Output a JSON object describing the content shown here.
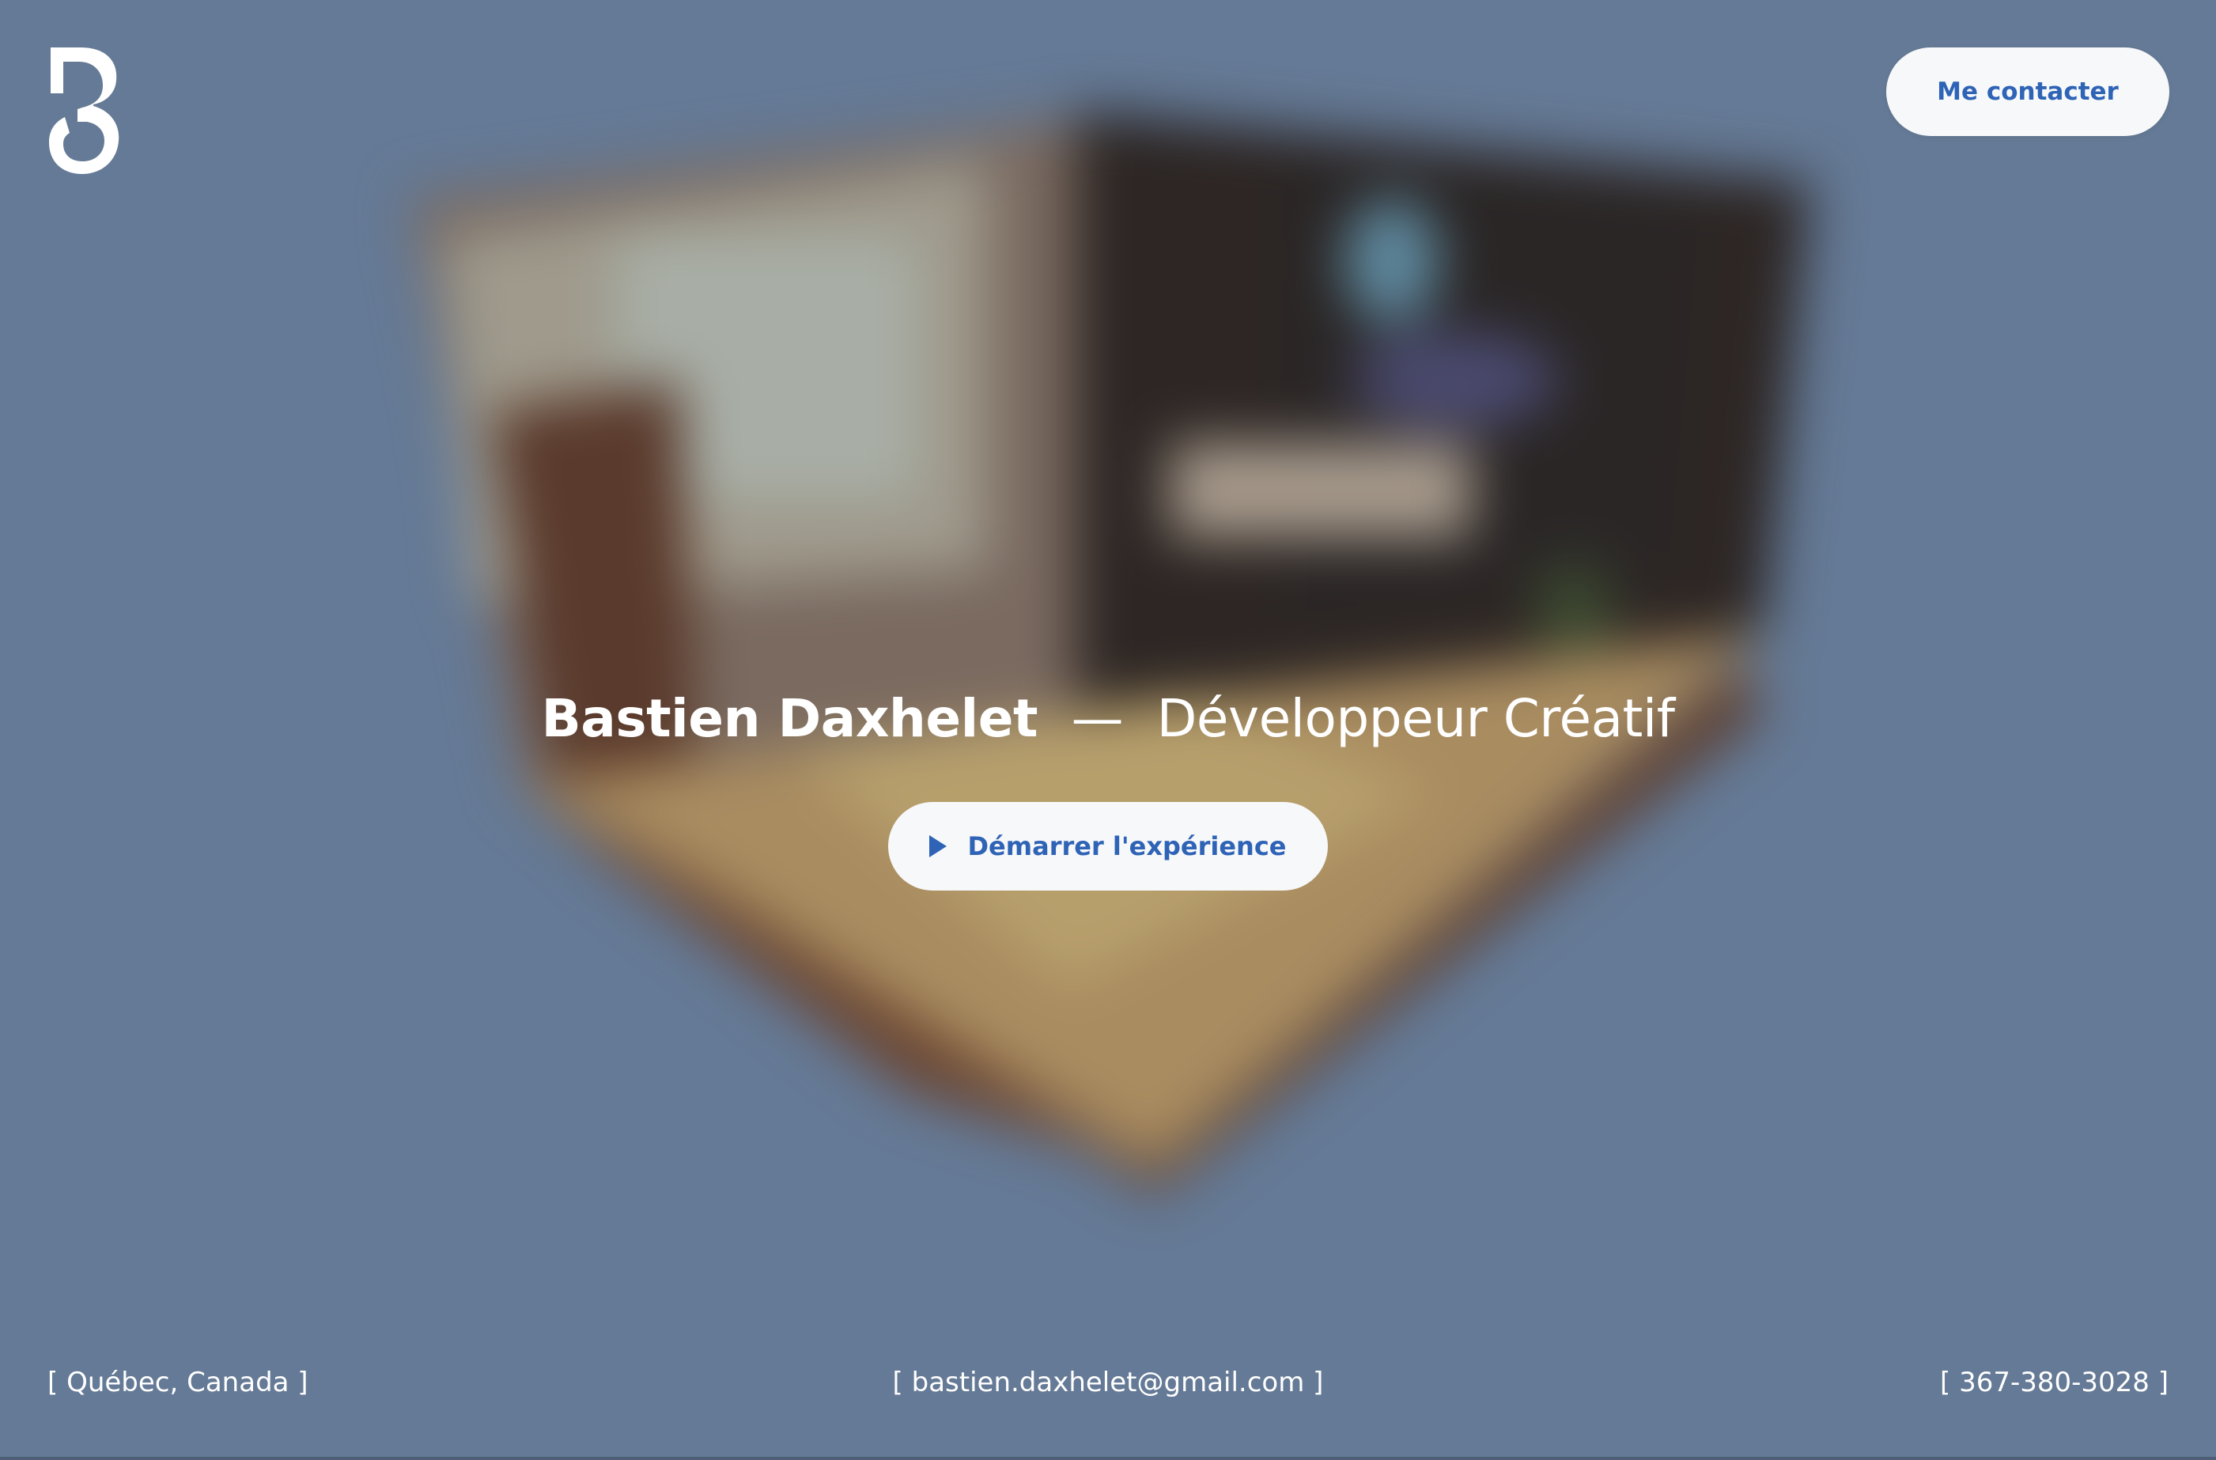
{
  "colors": {
    "background": "#657a96",
    "button_bg": "#f7f8fa",
    "accent": "#2e63b6",
    "text_light": "#ffffff"
  },
  "header": {
    "logo_icon": "bd-monogram-logo",
    "contact_button_label": "Me contacter"
  },
  "hero": {
    "name": "Bastien Daxhelet",
    "separator": "—",
    "role": "Développeur Créatif",
    "start_button_icon": "play-icon",
    "start_button_label": "Démarrer l'expérience"
  },
  "footer": {
    "location": "[ Québec, Canada ]",
    "email": "[ bastien.daxhelet@gmail.com ]",
    "phone": "[ 367-380-3028 ]"
  }
}
